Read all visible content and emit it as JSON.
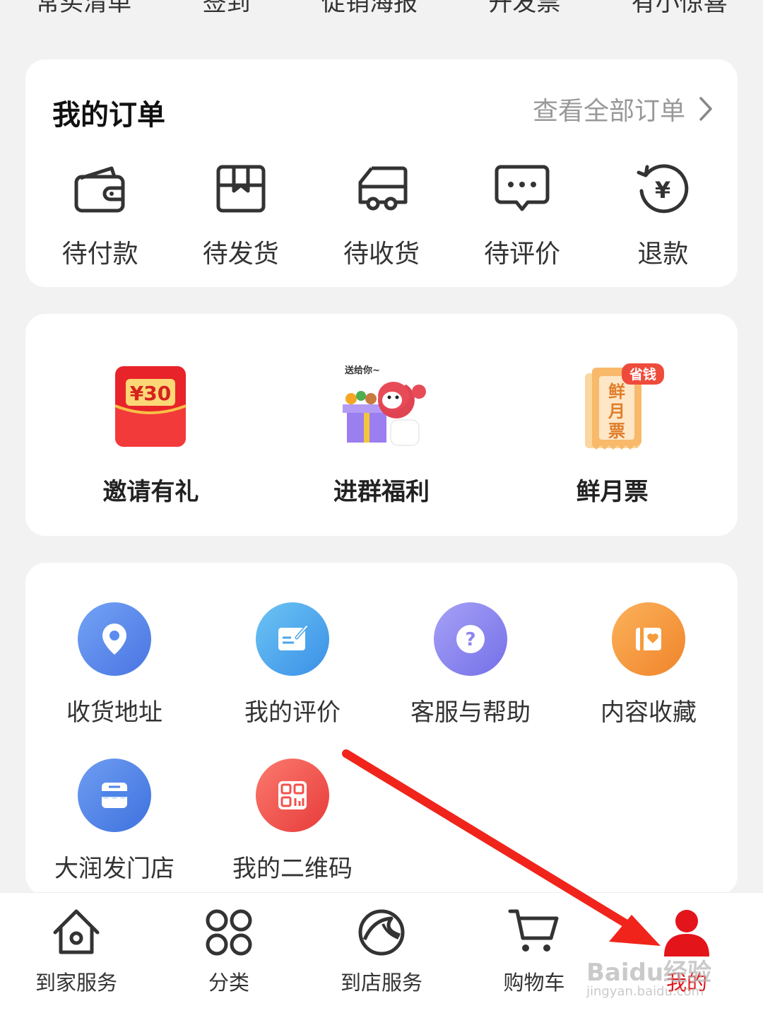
{
  "top_strip": [
    "常买清单",
    "签到",
    "促销海报",
    "开发票",
    "有小惊喜"
  ],
  "orders": {
    "title": "我的订单",
    "view_all": "查看全部订单",
    "items": [
      {
        "label": "待付款",
        "icon": "wallet-icon"
      },
      {
        "label": "待发货",
        "icon": "package-icon"
      },
      {
        "label": "待收货",
        "icon": "truck-icon"
      },
      {
        "label": "待评价",
        "icon": "comment-icon"
      },
      {
        "label": "退款",
        "icon": "refund-icon"
      }
    ]
  },
  "promos": {
    "items": [
      {
        "label": "邀请有礼",
        "badge": "¥30",
        "icon": "red-envelope-icon"
      },
      {
        "label": "进群福利",
        "caption": "送给你~",
        "icon": "gift-mascot-icon"
      },
      {
        "label": "鲜月票",
        "badge": "省钱",
        "ticket_text": "鲜月票",
        "icon": "ticket-icon"
      }
    ]
  },
  "tools": {
    "items": [
      {
        "label": "收货地址",
        "icon": "location-pin-icon",
        "color": "#5b8dee"
      },
      {
        "label": "我的评价",
        "icon": "edit-note-icon",
        "color": "#4aa6ec"
      },
      {
        "label": "客服与帮助",
        "icon": "help-icon",
        "color": "#8a86ef"
      },
      {
        "label": "内容收藏",
        "icon": "bookmark-heart-icon",
        "color": "#f59b3a"
      },
      {
        "label": "大润发门店",
        "icon": "store-icon",
        "color": "#4d86e8"
      },
      {
        "label": "我的二维码",
        "icon": "qr-code-icon",
        "color": "#f2514c"
      }
    ]
  },
  "bottom_nav": {
    "items": [
      {
        "label": "到家服务",
        "icon": "home-icon"
      },
      {
        "label": "分类",
        "icon": "category-icon"
      },
      {
        "label": "到店服务",
        "icon": "store-service-icon"
      },
      {
        "label": "购物车",
        "icon": "cart-icon"
      },
      {
        "label": "我的",
        "icon": "user-icon",
        "active": true
      }
    ]
  },
  "colors": {
    "accent": "#e4141b",
    "annotation_arrow": "#f0241b"
  },
  "watermark": {
    "text": "Baidu经验",
    "sub": "jingyan.baidu.com"
  }
}
